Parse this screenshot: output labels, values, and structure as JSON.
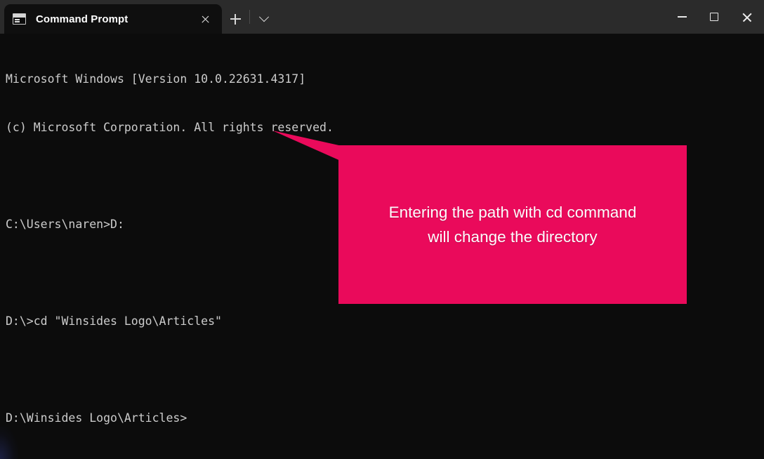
{
  "window": {
    "title": "Command Prompt",
    "controls": {
      "minimize_label": "Minimize",
      "maximize_label": "Maximize",
      "close_label": "Close"
    }
  },
  "tabbar": {
    "active_tab": "Command Prompt",
    "tab_close_label": "Close tab",
    "new_tab_label": "New tab",
    "tab_menu_label": "Open new tab dropdown"
  },
  "console": {
    "background_color": "#0c0c0c",
    "text_color": "#cccccc",
    "lines": [
      "Microsoft Windows [Version 10.0.22631.4317]",
      "(c) Microsoft Corporation. All rights reserved.",
      "",
      "C:\\Users\\naren>D:",
      "",
      "D:\\>cd \"Winsides Logo\\Articles\"",
      "",
      "D:\\Winsides Logo\\Articles>"
    ]
  },
  "callout": {
    "text": "Entering the path with cd command\nwill change the directory",
    "background_color": "#ea0a5b",
    "text_color": "#fdfdfd"
  }
}
